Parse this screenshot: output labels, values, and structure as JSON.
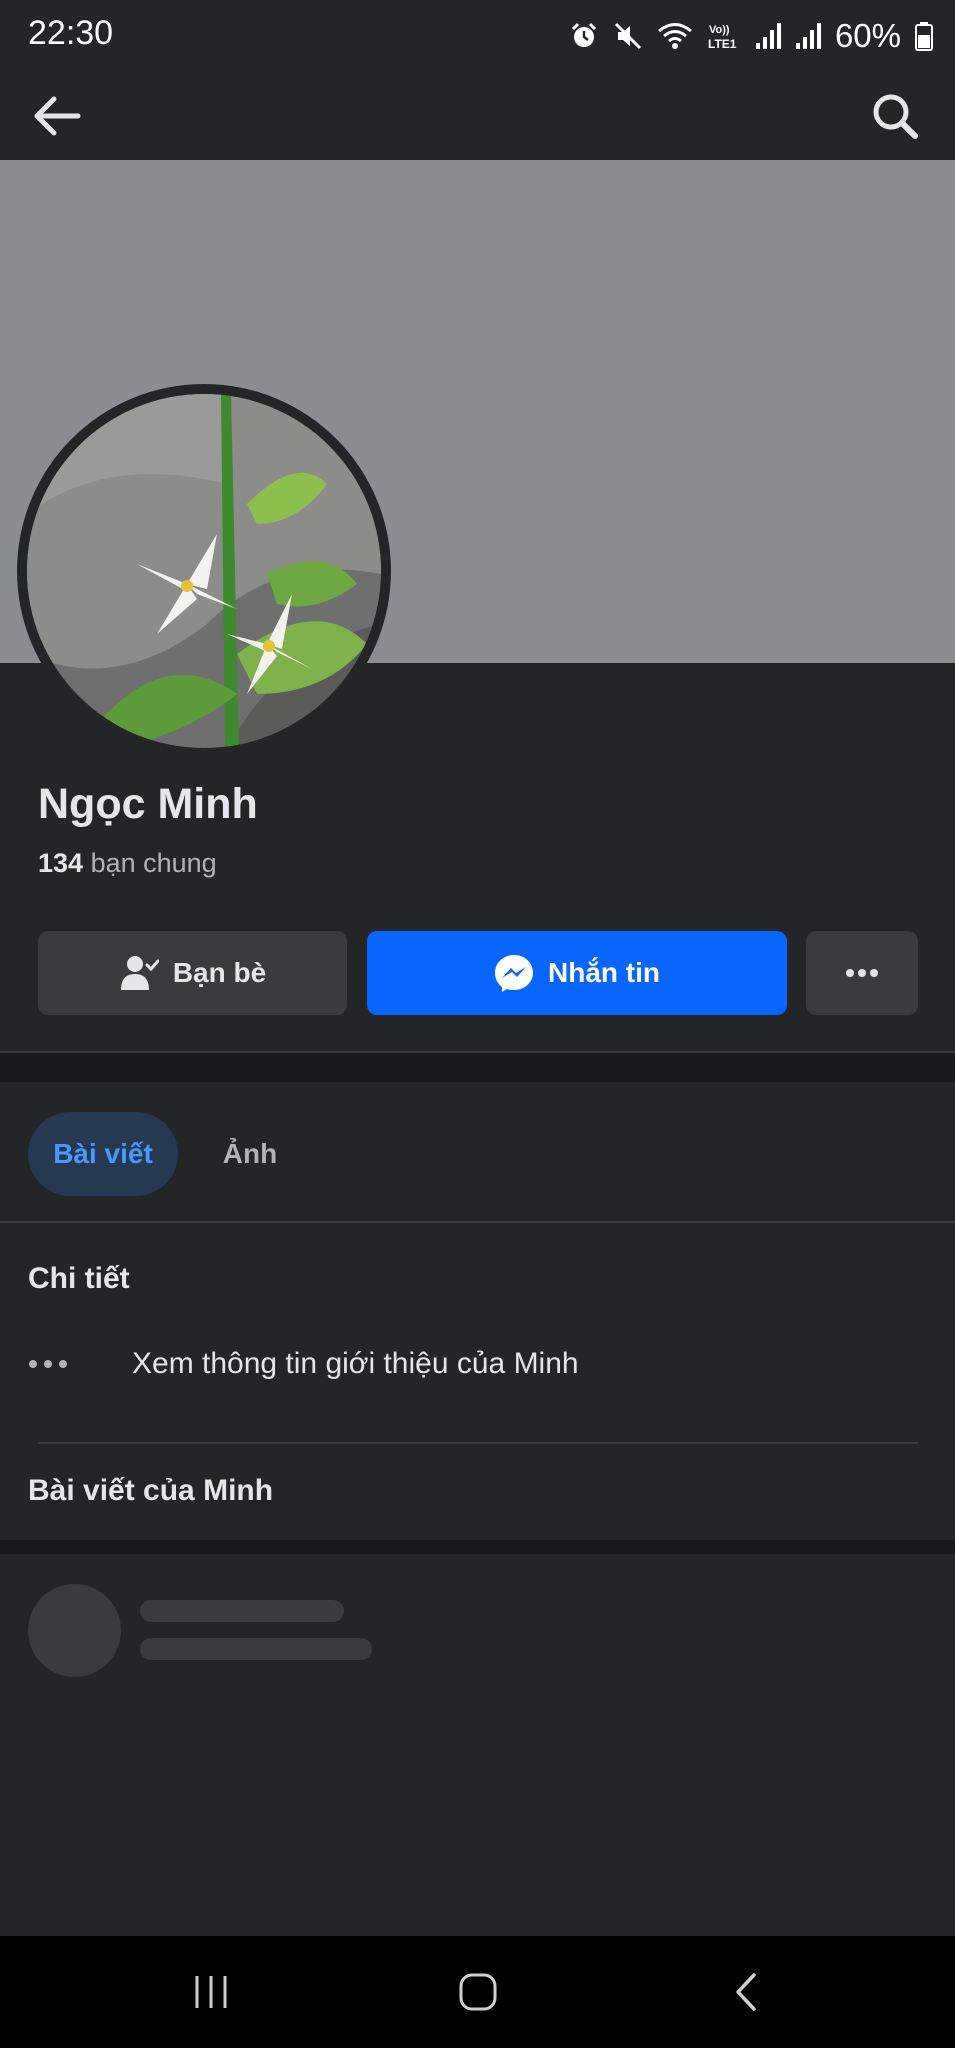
{
  "status_bar": {
    "time": "22:30",
    "battery": "60%",
    "icons": [
      "alarm-icon",
      "mute-icon",
      "wifi-icon",
      "volte-lte-icon",
      "signal-icon",
      "signal-icon",
      "battery-icon"
    ]
  },
  "nav": {
    "back_icon": "arrow-left-icon",
    "search_icon": "search-icon"
  },
  "profile": {
    "name": "Ngọc Minh",
    "mutual_count": "134",
    "mutual_label": " bạn chung",
    "avatar_description": "avatar-image"
  },
  "actions": {
    "friends_label": "Bạn bè",
    "message_label": "Nhắn tin",
    "more_icon": "more-horizontal-icon"
  },
  "tabs": [
    {
      "label": "Bài viết",
      "active": true
    },
    {
      "label": "Ảnh",
      "active": false
    }
  ],
  "details": {
    "title": "Chi tiết",
    "about_link": "Xem thông tin giới thiệu của Minh"
  },
  "posts": {
    "title": "Bài viết của Minh"
  },
  "colors": {
    "background": "#242526",
    "cover": "#8a8d91",
    "primary_button": "#0866ff",
    "secondary_button": "#3a3b3c",
    "active_tab_bg": "#263951",
    "active_tab_text": "#4599ff"
  }
}
